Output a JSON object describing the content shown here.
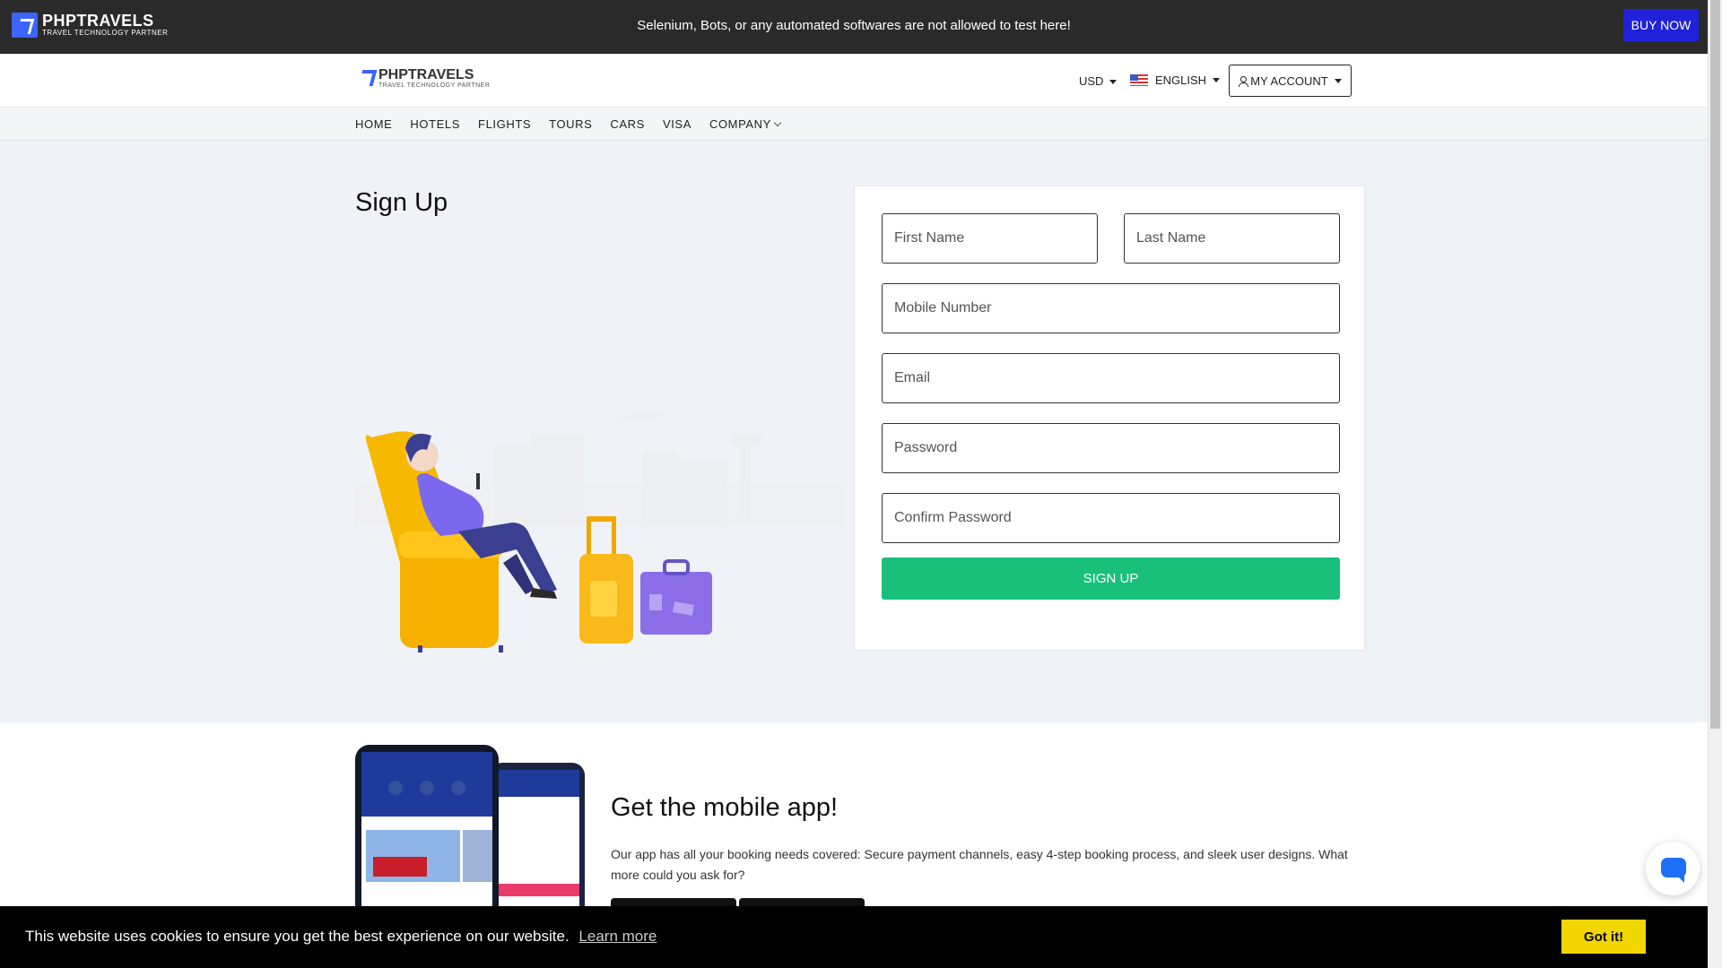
{
  "topbar": {
    "logo_name": "PHPTRAVELS",
    "logo_tagline": "TRAVEL TECHNOLOGY PARTNER",
    "warning": "Selenium, Bots, or any automated softwares are not allowed to test here!",
    "buy_now": "BUY NOW"
  },
  "header": {
    "logo_name": "PHPTRAVELS",
    "logo_tagline": "TRAVEL TECHNOLOGY PARTNER",
    "currency": "USD",
    "language": "ENGLISH",
    "account": "MY ACCOUNT"
  },
  "nav": {
    "items": [
      "HOME",
      "HOTELS",
      "FLIGHTS",
      "TOURS",
      "CARS",
      "VISA",
      "COMPANY"
    ]
  },
  "signup": {
    "title": "Sign Up",
    "first_name_placeholder": "First Name",
    "last_name_placeholder": "Last Name",
    "mobile_placeholder": "Mobile Number",
    "email_placeholder": "Email",
    "password_placeholder": "Password",
    "confirm_password_placeholder": "Confirm Password",
    "submit": "SIGN UP"
  },
  "app": {
    "title": "Get the mobile app!",
    "description": "Our app has all your booking needs covered: Secure payment channels, easy 4-step booking process, and sleek user designs. What more could you ask for?"
  },
  "cookie": {
    "message": "This website uses cookies to ensure you get the best experience on our website.",
    "learn_more": "Learn more",
    "accept": "Got it!"
  },
  "colors": {
    "brand_blue": "#3e64ff",
    "buy_now": "#1f22d8",
    "signup_green": "#18c07a",
    "cookie_button": "#f1d600"
  }
}
